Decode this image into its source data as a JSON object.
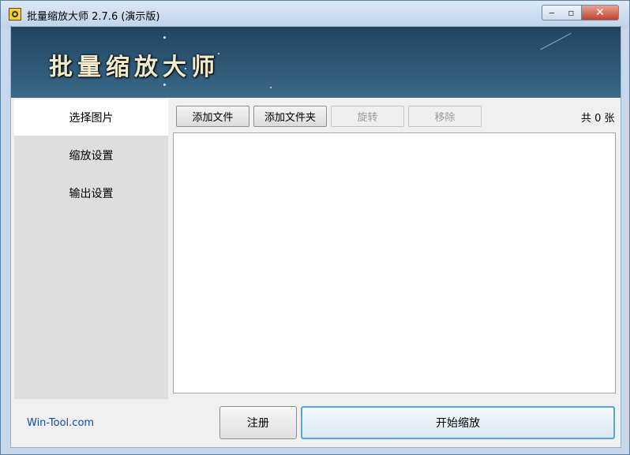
{
  "window": {
    "title": "批量缩放大师 2.7.6 (演示版)"
  },
  "banner": {
    "title": "批量缩放大师"
  },
  "sidebar": {
    "items": [
      {
        "label": "选择图片"
      },
      {
        "label": "缩放设置"
      },
      {
        "label": "输出设置"
      }
    ]
  },
  "toolbar": {
    "add_file": "添加文件",
    "add_folder": "添加文件夹",
    "rotate": "旋转",
    "remove": "移除",
    "count": "共 0 张"
  },
  "footer": {
    "link": "Win-Tool.com",
    "register": "注册",
    "start": "开始缩放"
  }
}
